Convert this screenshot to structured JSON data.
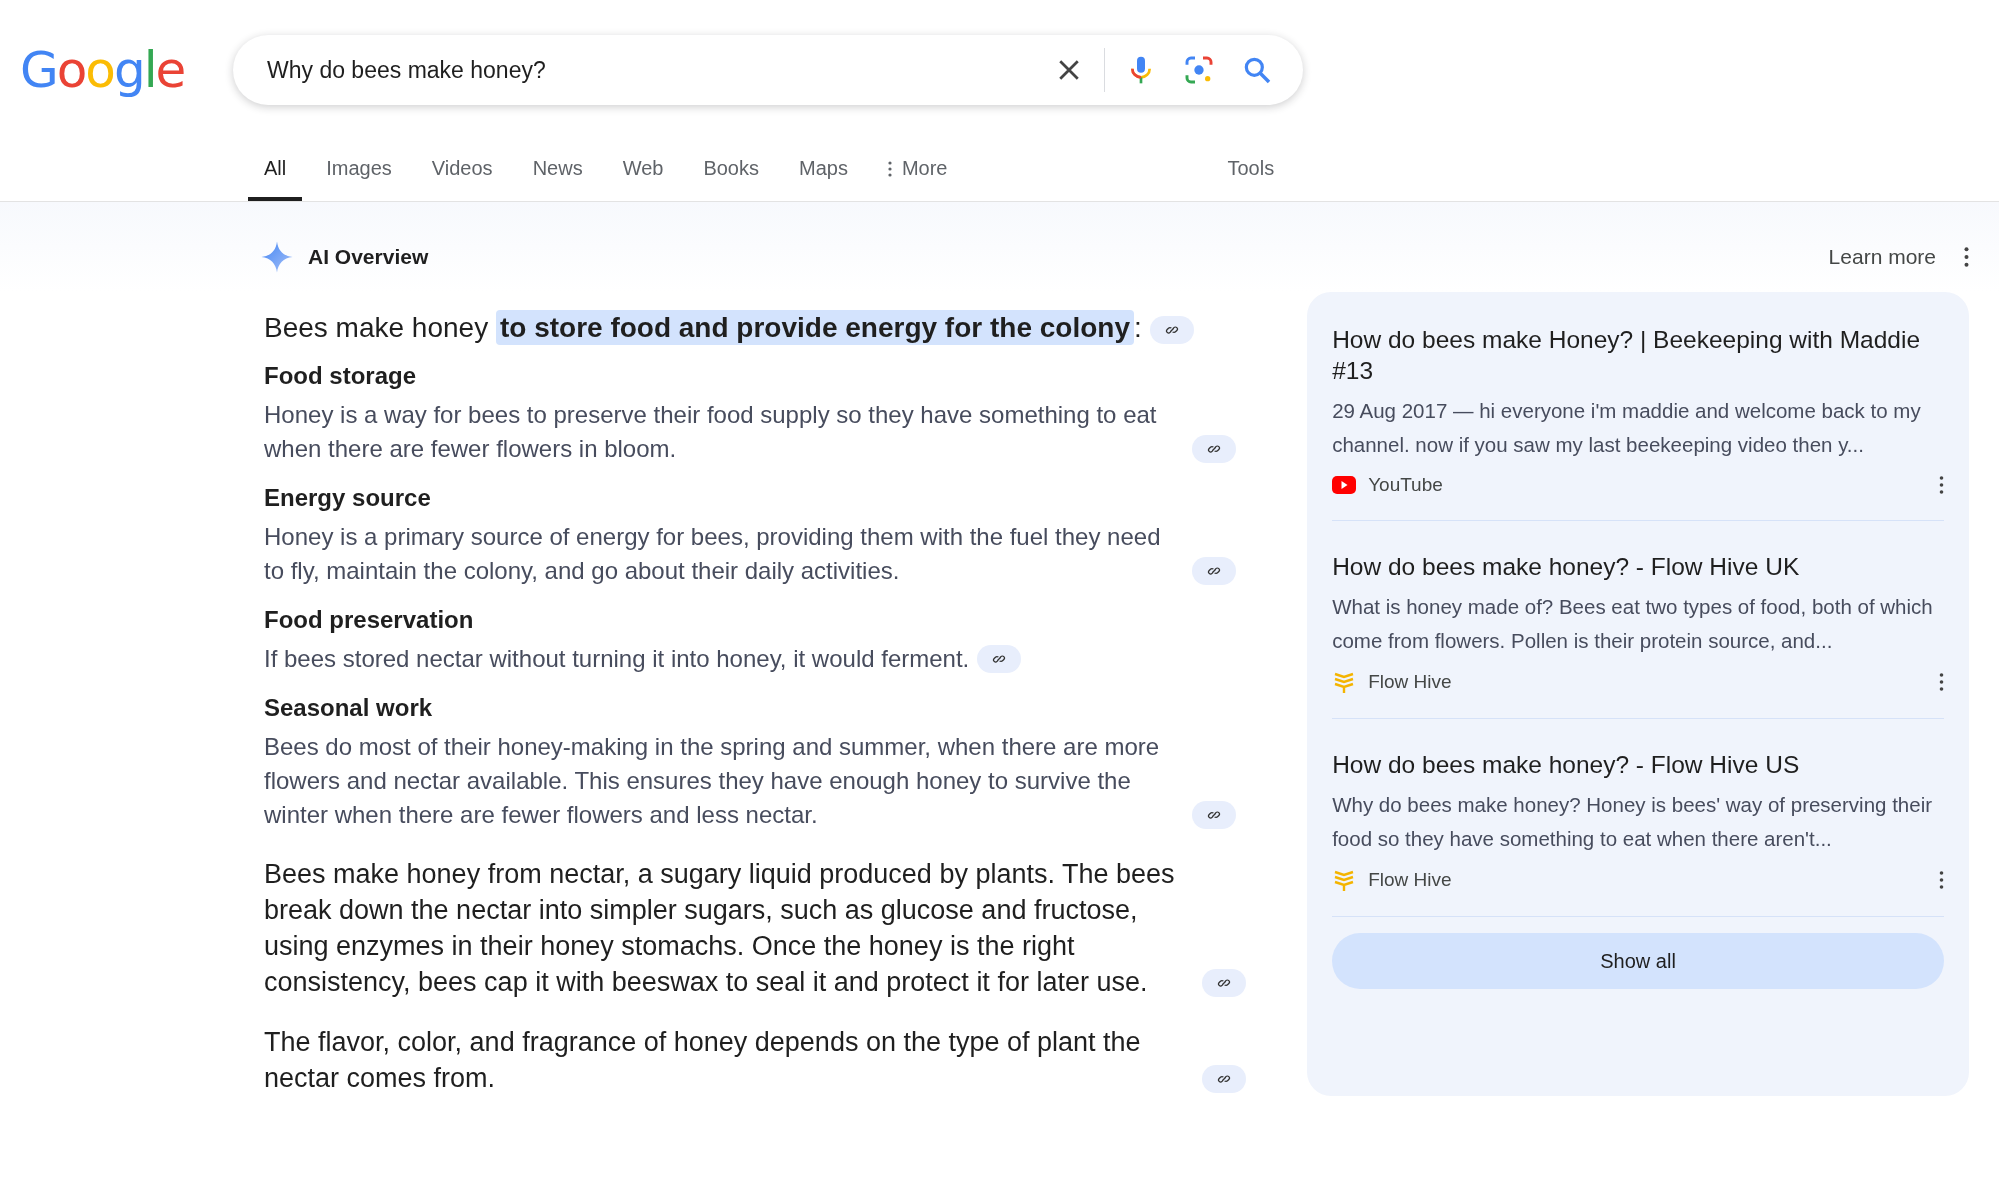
{
  "logo": "Google",
  "search": {
    "value": "Why do bees make honey?"
  },
  "tabs": [
    {
      "label": "All",
      "selected": true
    },
    {
      "label": "Images",
      "selected": false
    },
    {
      "label": "Videos",
      "selected": false
    },
    {
      "label": "News",
      "selected": false
    },
    {
      "label": "Web",
      "selected": false
    },
    {
      "label": "Books",
      "selected": false
    },
    {
      "label": "Maps",
      "selected": false
    },
    {
      "label": "More",
      "selected": false,
      "kind": "more"
    }
  ],
  "tools": "Tools",
  "overview": {
    "title": "AI Overview",
    "learn_more": "Learn more",
    "headline": {
      "text": "Bees make honey ",
      "highlight": "to store food and provide energy for the colony",
      "tail": ":"
    },
    "sections": [
      {
        "heading": "Food storage",
        "text": "Honey is a way for bees to preserve their food supply so they have something to eat when there are fewer flowers in bloom."
      },
      {
        "heading": "Energy source",
        "text": "Honey is a primary source of energy for bees, providing them with the fuel they need to fly, maintain the colony, and go about their daily activities."
      },
      {
        "heading": "Food preservation",
        "text": "If bees stored nectar without turning it into honey, it would ferment."
      },
      {
        "heading": "Seasonal work",
        "text": "Bees do most of their honey-making in the spring and summer, when there are more flowers and nectar available. This ensures they have enough honey to survive the winter when there are fewer flowers and less nectar."
      }
    ],
    "paragraphs": [
      "Bees make honey from nectar, a sugary liquid produced by plants. The bees break down the nectar into simpler sugars, such as glucose and fructose, using enzymes in their honey stomachs. Once the honey is the right consistency, bees cap it with beeswax to seal it and protect it for later use.",
      "The flavor, color, and fragrance of honey depends on the type of plant the nectar comes from."
    ],
    "sources": [
      {
        "title": "How do bees make Honey? | Beekeeping with Maddie #13",
        "snippet": "29 Aug 2017 — hi everyone i'm maddie and welcome back to my channel. now if you saw my last beekeeping video then y...",
        "site": "YouTube",
        "kind": "video"
      },
      {
        "title": "How do bees make honey? - Flow Hive UK",
        "snippet": "What is honey made of? Bees eat two types of food, both of which come from flowers. Pollen is their protein source, and...",
        "site": "Flow Hive",
        "kind": "hive"
      },
      {
        "title": "How do bees make honey? - Flow Hive US",
        "snippet": "Why do bees make honey? Honey is bees' way of preserving their food so they have something to eat when there aren't...",
        "site": "Flow Hive",
        "kind": "hive"
      }
    ],
    "show_all": "Show all"
  }
}
